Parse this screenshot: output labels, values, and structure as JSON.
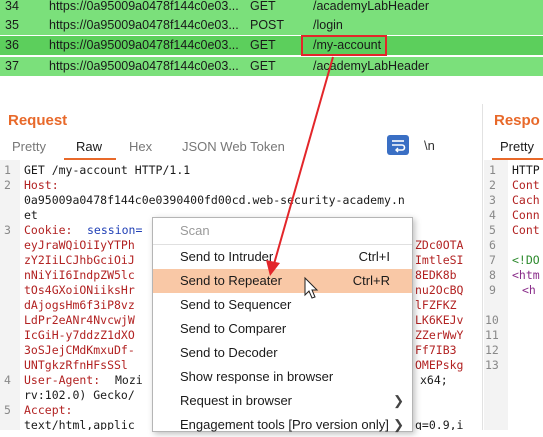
{
  "history": {
    "rows": [
      {
        "num": "34",
        "host": "https://0a95009a0478f144c0e03...",
        "method": "GET",
        "url": "/academyLabHeader"
      },
      {
        "num": "35",
        "host": "https://0a95009a0478f144c0e03...",
        "method": "POST",
        "url": "/login"
      },
      {
        "num": "36",
        "host": "https://0a95009a0478f144c0e03...",
        "method": "GET",
        "url": "/my-account"
      },
      {
        "num": "37",
        "host": "https://0a95009a0478f144c0e03...",
        "method": "GET",
        "url": "/academyLabHeader"
      }
    ]
  },
  "request": {
    "title": "Request",
    "tabs": [
      "Pretty",
      "Raw",
      "Hex",
      "JSON Web Token"
    ],
    "active_tab": "Raw",
    "newline_toggle": "\\n",
    "line_numbers": [
      "1",
      "2",
      "3",
      "4",
      "5",
      "6",
      "7",
      "8",
      "9"
    ],
    "lines": {
      "l1": "GET /my-account HTTP/1.1",
      "l2_key": "Host:",
      "l2_val": "0a95009a0478f144c0e0390400fd00cd.web-security-academy.n",
      "l2_cont": "et",
      "l3_key": "Cookie: ",
      "l3_val": "session=",
      "cookie_left": [
        "eyJraWQiOiIyYTPh",
        "zY2IiLCJhbGciOiJ",
        "nNiYiI6IndpZW5lc",
        "tOs4GXoiONiiksHr",
        "dAjogsHm6f3iP8vz",
        "LdPr2eANr4NvcwjW",
        "IcGiH-y7ddzZ1dXO",
        "3oSJejCMdKmxuDf-",
        "UNTgkzRfnHFsSSl"
      ],
      "cookie_right": [
        "ZDc0OTA",
        "ImtleSI",
        "8EDK8b",
        "nu2OcBQ",
        "lFZFKZ",
        "LK6KEJv",
        "ZZerWwY",
        "Ff7IB3",
        "OMEPskg"
      ],
      "ua_key": "User-Agent: ",
      "ua_val": "Mozi",
      "ua_tail": "x64;",
      "ua_cont": "rv:102.0) Gecko/",
      "accept_key": "Accept:",
      "accept_val": "text/html,applic",
      "accept_tail": "q=0.9,i"
    }
  },
  "response": {
    "title": "Respo",
    "tab": "Pretty",
    "line_numbers": [
      "1",
      "2",
      "3",
      "4",
      "5",
      "6",
      "7",
      "8",
      "9",
      "10",
      "11",
      "12",
      "13"
    ],
    "lines": [
      "HTTP",
      "Cont",
      "Cach",
      "Conn",
      "Cont",
      "",
      "<!DO",
      "<htm",
      "<h",
      "",
      "",
      "",
      ""
    ]
  },
  "context_menu": {
    "items": [
      {
        "label": "Scan",
        "shortcut": "",
        "disabled": true,
        "submenu": false
      },
      {
        "label": "Send to Intruder",
        "shortcut": "Ctrl+I",
        "disabled": false,
        "submenu": false
      },
      {
        "label": "Send to Repeater",
        "shortcut": "Ctrl+R",
        "disabled": false,
        "submenu": false,
        "highlighted": true
      },
      {
        "label": "Send to Sequencer",
        "shortcut": "",
        "disabled": false,
        "submenu": false
      },
      {
        "label": "Send to Comparer",
        "shortcut": "",
        "disabled": false,
        "submenu": false
      },
      {
        "label": "Send to Decoder",
        "shortcut": "",
        "disabled": false,
        "submenu": false
      },
      {
        "label": "Show response in browser",
        "shortcut": "",
        "disabled": false,
        "submenu": false
      },
      {
        "label": "Request in browser",
        "shortcut": "",
        "disabled": false,
        "submenu": true
      },
      {
        "label": "Engagement tools [Pro version only]",
        "shortcut": "",
        "disabled": false,
        "submenu": true
      }
    ]
  },
  "colors": {
    "row_green": "#7be07b",
    "row_selected": "#5ccf5c",
    "accent_orange": "#e8692a",
    "highlight_box": "#e3262a",
    "menu_highlight": "#f9c8a6"
  },
  "icons": [
    "wrap-icon",
    "chevron-right-icon",
    "cursor-icon",
    "arrow-annotation"
  ]
}
